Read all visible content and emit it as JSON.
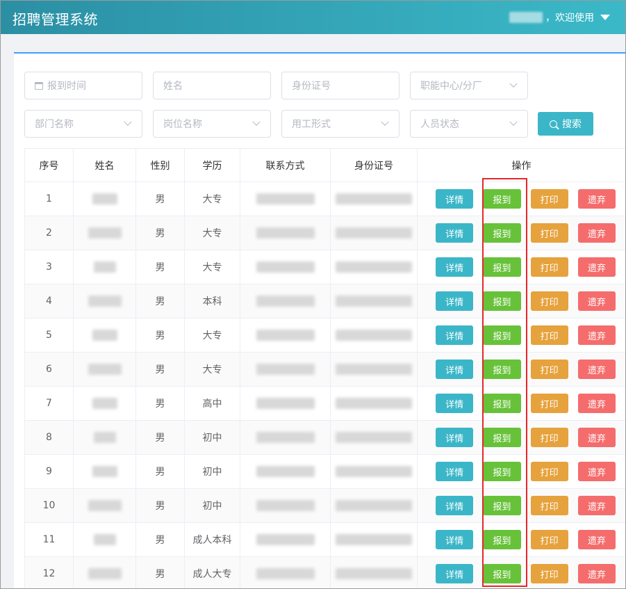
{
  "header": {
    "title": "招聘管理系统",
    "welcome": "，欢迎使用"
  },
  "filters": {
    "report_time": "报到时间",
    "name": "姓名",
    "id_number": "身份证号",
    "center": "职能中心/分厂",
    "department": "部门名称",
    "position": "岗位名称",
    "employment_type": "用工形式",
    "person_status": "人员状态",
    "search_label": "搜索"
  },
  "table": {
    "headers": {
      "index": "序号",
      "name": "姓名",
      "gender": "性别",
      "education": "学历",
      "contact": "联系方式",
      "id_number": "身份证号",
      "actions": "操作"
    },
    "actions": {
      "detail": "详情",
      "report": "报到",
      "print": "打印",
      "abandon": "遗弃"
    },
    "rows": [
      {
        "index": "1",
        "gender": "男",
        "education": "大专"
      },
      {
        "index": "2",
        "gender": "男",
        "education": "大专"
      },
      {
        "index": "3",
        "gender": "男",
        "education": "大专"
      },
      {
        "index": "4",
        "gender": "男",
        "education": "本科"
      },
      {
        "index": "5",
        "gender": "男",
        "education": "大专"
      },
      {
        "index": "6",
        "gender": "男",
        "education": "大专"
      },
      {
        "index": "7",
        "gender": "男",
        "education": "高中"
      },
      {
        "index": "8",
        "gender": "男",
        "education": "初中"
      },
      {
        "index": "9",
        "gender": "男",
        "education": "初中"
      },
      {
        "index": "10",
        "gender": "男",
        "education": "初中"
      },
      {
        "index": "11",
        "gender": "男",
        "education": "成人本科"
      },
      {
        "index": "12",
        "gender": "男",
        "education": "成人大专"
      }
    ]
  },
  "colors": {
    "header_start": "#2b8fa4",
    "header_end": "#3bb9c8",
    "detail": "#3bb6c8",
    "report": "#67c23a",
    "print": "#e6a23c",
    "abandon": "#f56c6c",
    "highlight": "#e8262a"
  }
}
